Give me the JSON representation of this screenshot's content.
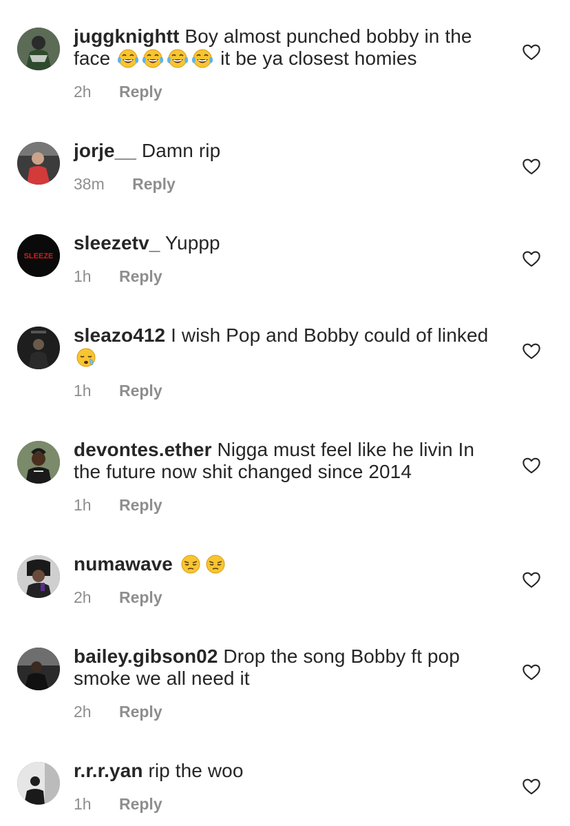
{
  "reply_label": "Reply",
  "comments": [
    {
      "username": "juggknightt",
      "text_before": "Boy almost punched bobby in the face",
      "emoji_count": 4,
      "emoji": "laughing-tears",
      "text_after": "it be ya closest homies",
      "time": "2h"
    },
    {
      "username": "jorje__",
      "text_before": "Damn rip",
      "emoji_count": 0,
      "text_after": "",
      "time": "38m"
    },
    {
      "username": "sleezetv_",
      "text_before": "Yuppp",
      "emoji_count": 0,
      "text_after": "",
      "time": "1h",
      "avatar_text": "SLEEZE"
    },
    {
      "username": "sleazo412",
      "text_before": "I wish Pop and Bobby could of linked",
      "emoji_count": 1,
      "emoji": "sleepy-face",
      "text_after": "",
      "time": "1h"
    },
    {
      "username": "devontes.ether",
      "text_before": "Nigga must feel like he livin In the future now shit changed since 2014",
      "emoji_count": 0,
      "text_after": "",
      "time": "1h"
    },
    {
      "username": "numawave",
      "text_before": "",
      "emoji_count": 2,
      "emoji": "pensive-face",
      "text_after": "",
      "time": "2h"
    },
    {
      "username": "bailey.gibson02",
      "text_before": "Drop the song Bobby ft pop smoke we all need it",
      "emoji_count": 0,
      "text_after": "",
      "time": "2h"
    },
    {
      "username": "r.r.r.yan",
      "text_before": "rip the woo",
      "emoji_count": 0,
      "text_after": "",
      "time": "1h"
    }
  ]
}
